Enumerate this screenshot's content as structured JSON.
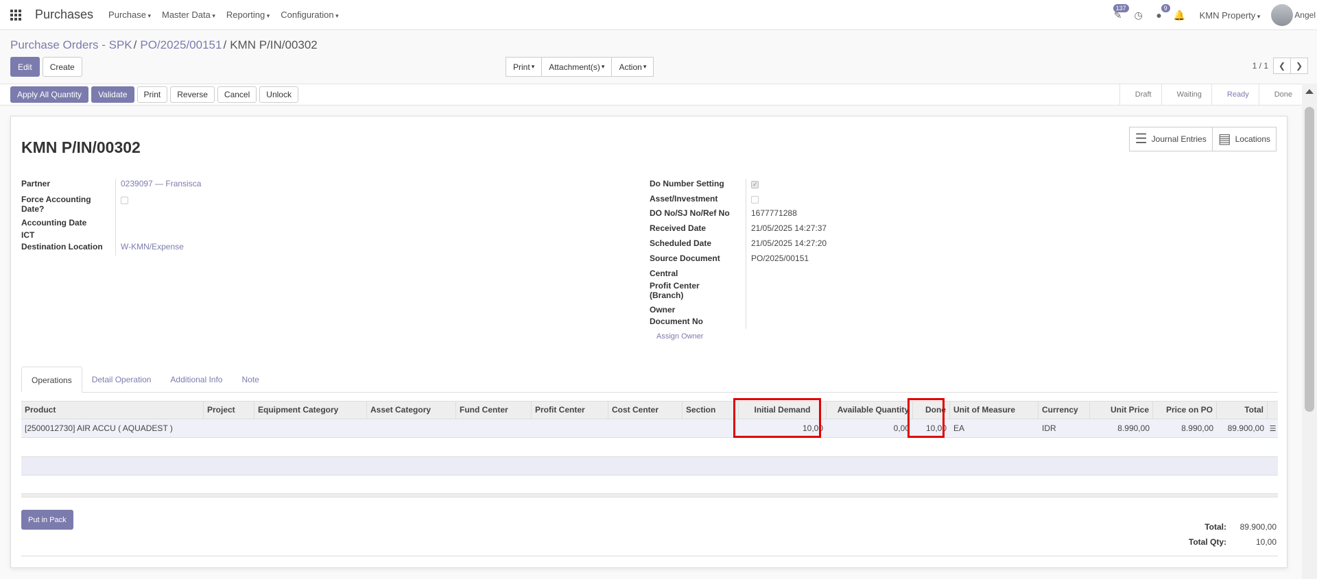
{
  "navbar": {
    "brand": "Purchases",
    "menus": [
      "Purchase",
      "Master Data",
      "Reporting",
      "Configuration"
    ],
    "activity_badge": "137",
    "messages_badge": "9",
    "company": "KMN Property",
    "user": "Angel"
  },
  "breadcrumb": {
    "items": [
      "Purchase Orders - SPK",
      "PO/2025/00151"
    ],
    "current": "KMN P/IN/00302",
    "separator": "/"
  },
  "control": {
    "edit_label": "Edit",
    "create_label": "Create",
    "print_label": "Print",
    "attachments_label": "Attachment(s)",
    "action_label": "Action",
    "pager": "1 / 1"
  },
  "statusbar": {
    "buttons": [
      "Apply All Quantity",
      "Validate",
      "Print",
      "Reverse",
      "Cancel",
      "Unlock"
    ],
    "stages": [
      "Draft",
      "Waiting",
      "Ready",
      "Done"
    ],
    "active_stage": "Ready"
  },
  "smart_buttons": {
    "journal": "Journal Entries",
    "locations": "Locations"
  },
  "document": {
    "title": "KMN P/IN/00302",
    "left": {
      "partner_label": "Partner",
      "partner_value": "0239097 — Fransisca",
      "force_label_1": "Force Accounting",
      "force_label_2": "Date?",
      "accounting_date_label": "Accounting Date",
      "ict_label": "ICT",
      "destination_label": "Destination Location",
      "destination_value": "W-KMN/Expense"
    },
    "right": {
      "do_number_label": "Do Number Setting",
      "asset_label": "Asset/Investment",
      "do_no_label": "DO No/SJ No/Ref No",
      "do_no_value": "1677771288",
      "received_label": "Received Date",
      "received_value": "21/05/2025 14:27:37",
      "scheduled_label": "Scheduled Date",
      "scheduled_value": "21/05/2025 14:27:20",
      "source_label": "Source Document",
      "source_value": "PO/2025/00151",
      "central_label": "Central",
      "profit_center_label_1": "Profit Center",
      "profit_center_label_2": "(Branch)",
      "owner_label": "Owner",
      "document_no_label": "Document No"
    },
    "assign_owner": "Assign Owner"
  },
  "tabs": [
    "Operations",
    "Detail Operation",
    "Additional Info",
    "Note"
  ],
  "table": {
    "headers": [
      "Product",
      "Project",
      "Equipment Category",
      "Asset Category",
      "Fund Center",
      "Profit Center",
      "Cost Center",
      "Section",
      "Initial Demand",
      "Available Quantity",
      "Done",
      "Unit of Measure",
      "Currency",
      "Unit Price",
      "Price on PO",
      "Total"
    ],
    "row": {
      "product": "[2500012730] AIR ACCU ( AQUADEST )",
      "initial_demand": "10,00",
      "available": "0,00",
      "done": "10,00",
      "uom": "EA",
      "currency": "IDR",
      "unit_price": "8.990,00",
      "price_on_po": "8.990,00",
      "total": "89.900,00"
    }
  },
  "footer": {
    "pack_label": "Put in Pack",
    "total_label": "Total:",
    "total_value": "89.900,00",
    "total_qty_label": "Total Qty:",
    "total_qty_value": "10,00"
  },
  "colors": {
    "primary": "#7c7bad",
    "highlight": "#e00000"
  }
}
